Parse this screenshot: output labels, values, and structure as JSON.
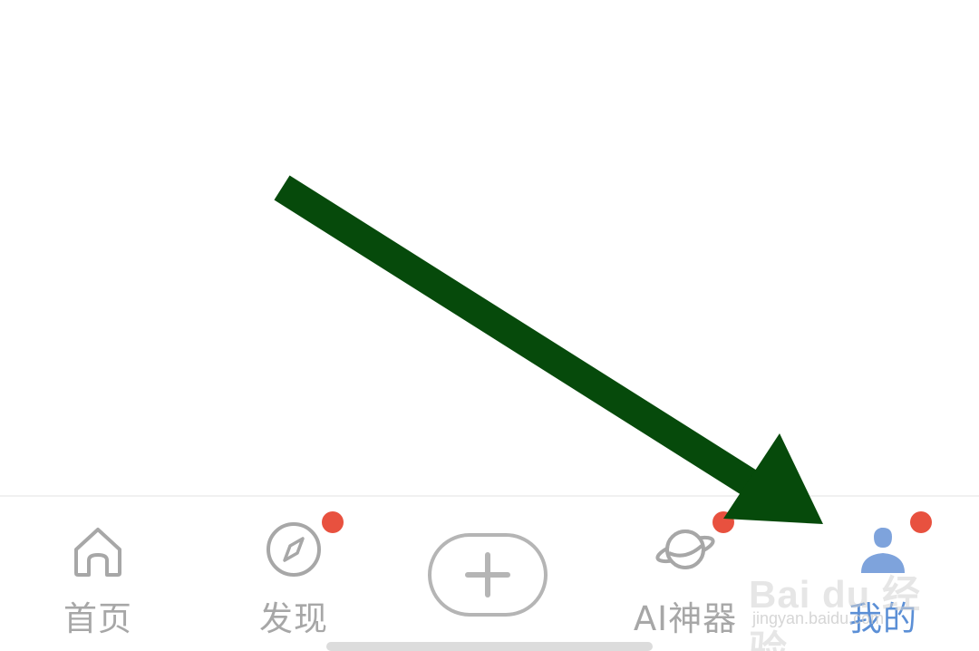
{
  "tabbar": {
    "items": [
      {
        "label": "首页",
        "icon": "home-icon",
        "badge": false
      },
      {
        "label": "发现",
        "icon": "compass-icon",
        "badge": true
      },
      {
        "label": "",
        "icon": "plus-icon",
        "badge": false
      },
      {
        "label": "AI神器",
        "icon": "planet-icon",
        "badge": true
      },
      {
        "label": "我的",
        "icon": "user-icon",
        "badge": true
      }
    ]
  },
  "watermark": {
    "brand": "Bai du 经验",
    "site": "jingyan.baidu.com"
  },
  "colors": {
    "inactive": "#a7a7a7",
    "active": "#5b8fd6",
    "badge": "#e8513f",
    "arrow": "#064a0b"
  }
}
